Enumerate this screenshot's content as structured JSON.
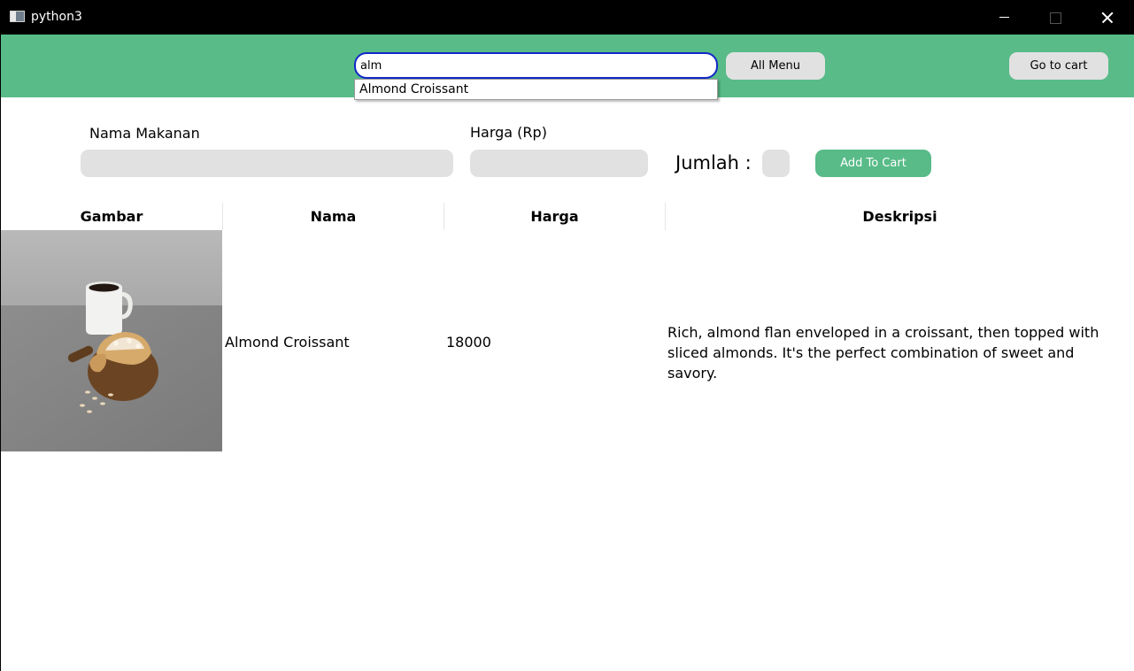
{
  "window": {
    "title": "python3",
    "icon": "app-window-icon"
  },
  "header": {
    "background": "#58bb88",
    "search_value": "alm",
    "all_menu_label": "All Menu",
    "cart_label": "Go to cart"
  },
  "autocomplete": {
    "items": [
      "Almond Croissant"
    ]
  },
  "form": {
    "nama_label": "Nama Makanan",
    "harga_label": "Harga (Rp)",
    "jumlah_label": "Jumlah :",
    "add_label": "Add To Cart"
  },
  "table": {
    "headers": [
      "Gambar",
      "Nama",
      "Harga",
      "Deskripsi"
    ],
    "rows": [
      {
        "image": "almond-croissant-photo",
        "nama": "Almond Croissant",
        "harga": "18000",
        "deskripsi": "Rich, almond flan enveloped in a croissant, then topped with sliced almonds. It's the perfect combination of sweet and savory."
      }
    ]
  }
}
